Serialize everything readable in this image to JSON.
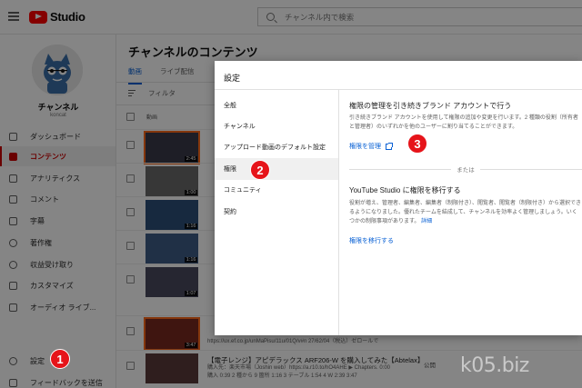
{
  "header": {
    "logo_text": "Studio",
    "search_placeholder": "チャンネル内で検索"
  },
  "sidebar": {
    "channel_name": "チャンネル",
    "channel_handle": "koncat",
    "items": [
      {
        "label": "ダッシュボード",
        "icon": "dashboard-icon"
      },
      {
        "label": "コンテンツ",
        "icon": "video-icon",
        "active": true
      },
      {
        "label": "アナリティクス",
        "icon": "analytics-icon"
      },
      {
        "label": "コメント",
        "icon": "comment-icon"
      },
      {
        "label": "字幕",
        "icon": "subtitles-icon"
      },
      {
        "label": "著作権",
        "icon": "copyright-icon"
      },
      {
        "label": "収益受け取り",
        "icon": "monetization-icon"
      },
      {
        "label": "カスタマイズ",
        "icon": "customize-icon"
      },
      {
        "label": "オーディオ ライブ...",
        "icon": "audio-library-icon"
      }
    ],
    "settings_label": "設定",
    "feedback_label": "フィードバックを送信"
  },
  "main": {
    "title": "チャンネルのコンテンツ",
    "tabs": [
      "動画",
      "ライブ配信"
    ],
    "filter_label": "フィルタ",
    "column_video": "動画",
    "rows": [
      {
        "duration": "2:45",
        "highlight": true
      },
      {
        "duration": "1:00",
        "highlight": false
      },
      {
        "duration": "1:16",
        "highlight": false
      },
      {
        "duration": "1:16",
        "highlight": false
      },
      {
        "duration": "1:07",
        "highlight": false
      },
      {
        "duration": "3:47",
        "highlight": true
      }
    ],
    "row6_desc": "https://ux.ef.co.jp/unMaPisu/11u/01Q/v#n 27/62/04（税込）ゼロールで",
    "bottom_title": "【電子レンジ】アピデラックス ARF206-W を購入してみた【Abtelax】",
    "bottom_desc1": "購入先：楽天市場（Joshin web）https://a.r10.to/hO4AHE ▶ Chapters. 0:00",
    "bottom_desc2": "購入 0:39 2 種から 9 箇所 1:16 3 テーブル 1:54 4 W 2:39 3:47",
    "visibility": "公開"
  },
  "dialog": {
    "title": "設定",
    "nav": [
      "全般",
      "チャンネル",
      "アップロード動画のデフォルト設定",
      "権限",
      "コミュニティ",
      "契約"
    ],
    "active_index": 3,
    "section1_title": "権限の管理を引き続きブランド アカウントで行う",
    "section1_desc": "引き続きブランド アカウントを使用して権限の追加や変更を行います。2 種類の役割（所有者と管理者）のいずれかを他のユーザーに割り当てることができます。",
    "manage_link": "権限を管理",
    "or_text": "または",
    "section2_title": "YouTube Studio に権限を移行する",
    "section2_desc": "役割が増え、管理者、編集者、編集者（制限付き）、閲覧者、閲覧者（制限付き）から選択できるようになりました。優れたチームを結成して、チャンネルを効率よく管理しましょう。いくつかの制限事項があります。",
    "section2_desc_link": "詳細",
    "migrate_link": "権限を移行する"
  },
  "badges": [
    "1",
    "2",
    "3"
  ],
  "watermark": "k05.biz",
  "colors": {
    "accent": "#065fd4",
    "active_nav": "#cc0000",
    "badge": "#e6141a"
  }
}
